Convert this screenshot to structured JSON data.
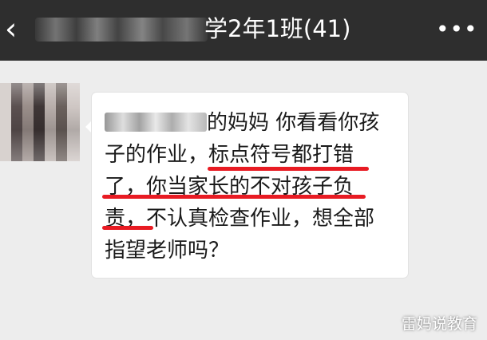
{
  "header": {
    "back_icon": "chevron-left-icon",
    "title": "学2年1班(41)",
    "more_icon": "more-dots-icon",
    "more_glyph": "•••"
  },
  "message": {
    "lines": [
      "的妈妈 你看看你孩",
      "子的作业，标点符号都打错",
      "了，你当家长的不对孩子负",
      "责，不认真检查作业，想全部",
      "指望老师吗？"
    ],
    "underline_color": "#e81b23"
  },
  "watermark": "雷妈说教育"
}
